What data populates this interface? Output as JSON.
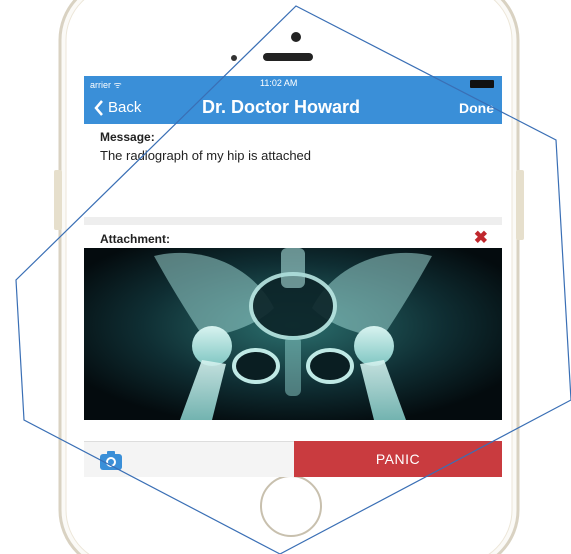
{
  "status_bar": {
    "carrier": "arrier ᯤ",
    "time": "11:02 AM"
  },
  "nav": {
    "back_label": "Back",
    "title": "Dr. Doctor Howard",
    "done_label": "Done"
  },
  "message": {
    "label": "Message:",
    "text": "The radiograph of my hip is attached"
  },
  "attachment": {
    "label": "Attachment:",
    "remove_icon": "✖"
  },
  "toolbar": {
    "panic_label": "PANIC"
  },
  "colors": {
    "accent": "#3a8fd8",
    "panic": "#c93b3f",
    "remove": "#c0272d"
  }
}
